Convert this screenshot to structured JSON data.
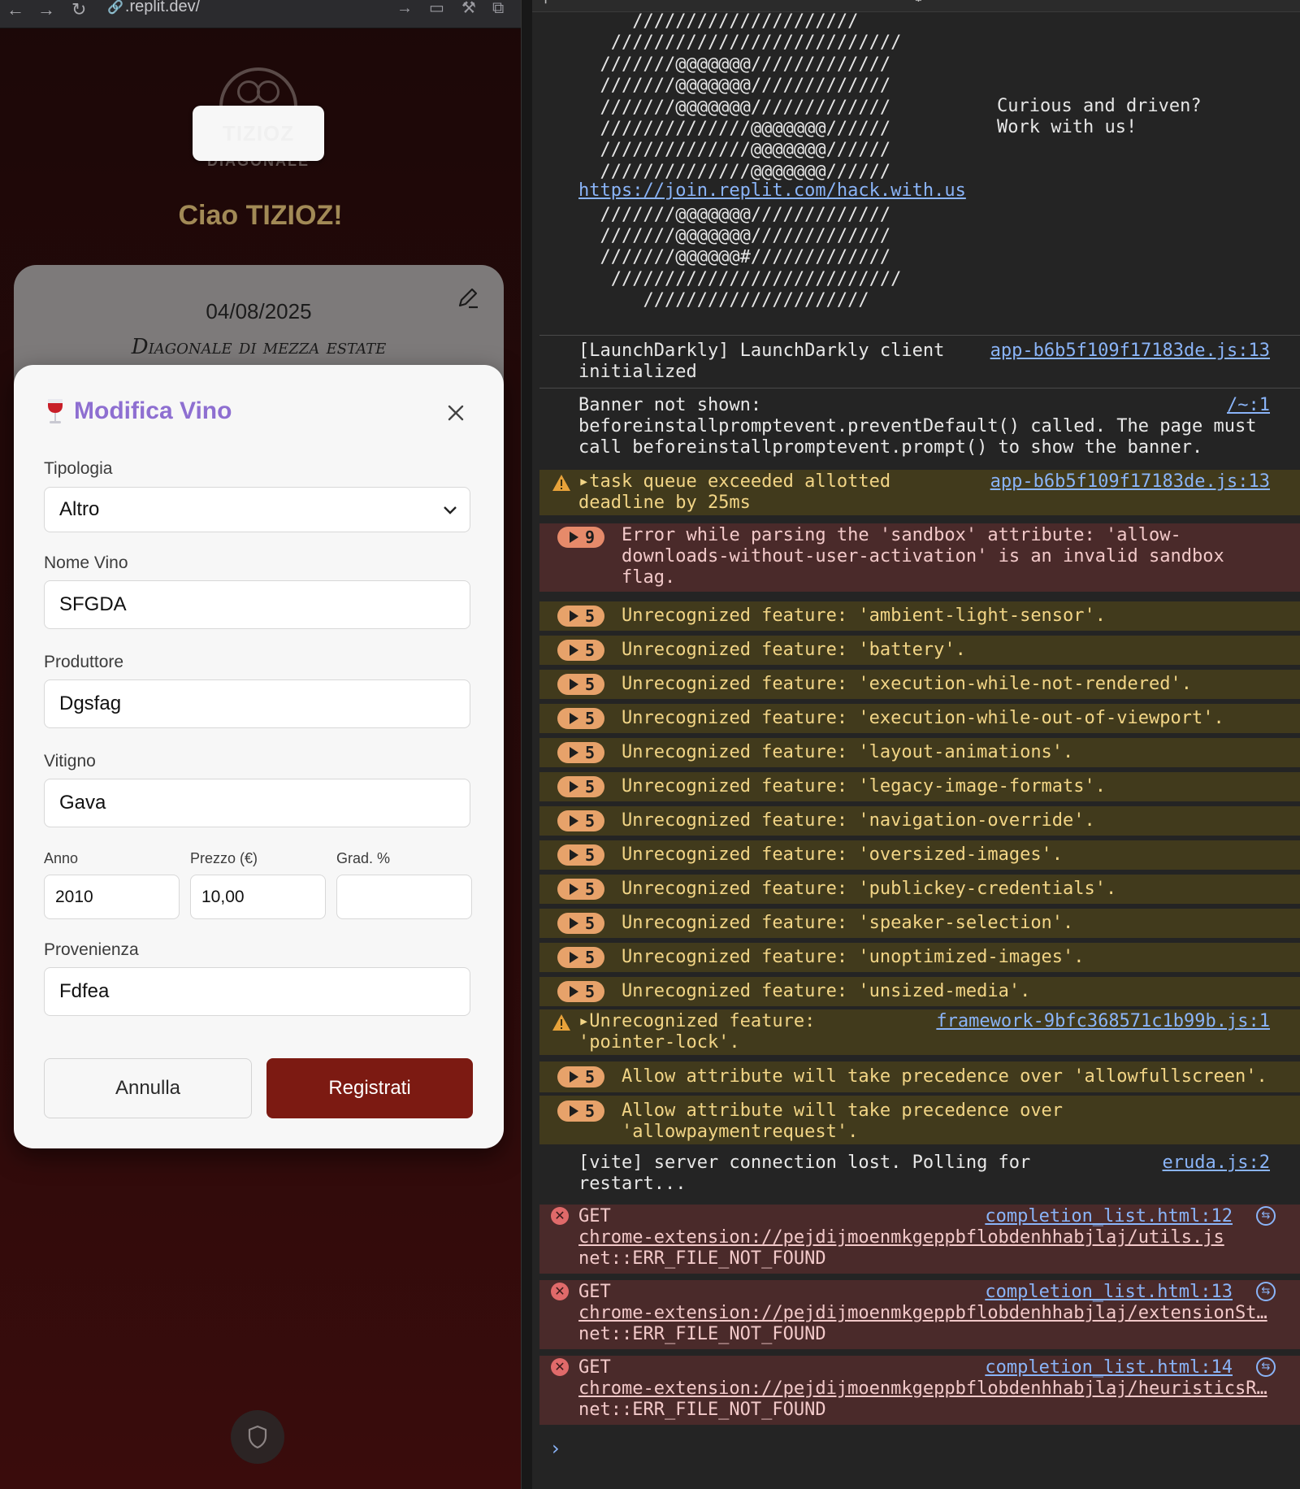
{
  "browser": {
    "url": ".replit.dev/",
    "back": "←",
    "forward": "→",
    "reload": "↻"
  },
  "app": {
    "logo_text": "TIZIOZ",
    "logo_subtext": "DIAGONALE",
    "greeting": "Ciao TIZIOZ!",
    "event": {
      "date": "04/08/2025",
      "title": "Diagonale di mezza estate"
    }
  },
  "modal": {
    "title": "Modifica Vino",
    "fields": {
      "tipologia": {
        "label": "Tipologia",
        "value": "Altro"
      },
      "nome_vino": {
        "label": "Nome Vino",
        "value": "SFGDA"
      },
      "produttore": {
        "label": "Produttore",
        "value": "Dgsfag"
      },
      "vitigno": {
        "label": "Vitigno",
        "value": "Gava"
      },
      "anno": {
        "label": "Anno",
        "value": "2010"
      },
      "prezzo": {
        "label": "Prezzo (€)",
        "value": "10,00"
      },
      "grad": {
        "label": "Grad. %",
        "value": ""
      },
      "provenienza": {
        "label": "Provenienza",
        "value": "Fdfea"
      }
    },
    "cancel_label": "Annulla",
    "submit_label": "Registrati",
    "accent": "#8e6fd1",
    "submit_color": "#7c1a12"
  },
  "console": {
    "ascii_art": "     /////////////////////\n   ///////////////////////////\n  ///////@@@@@@@/////////////\n  ///////@@@@@@@/////////////\n  ///////@@@@@@@/////////////\n  //////////////@@@@@@@//////\n  //////////////@@@@@@@//////\n  //////////////@@@@@@@//////\n\n  ///////@@@@@@@/////////////\n  ///////@@@@@@@/////////////\n  ///////@@@@@@#/////////////\n   ///////////////////////////\n      /////////////////////",
    "hack_link": "https://join.replit.com/hack.with.us",
    "curious_text": "Curious and driven?\nWork with us!",
    "launchdarkly": {
      "msg": "[LaunchDarkly] LaunchDarkly client\ninitialized",
      "src": "app-b6b5f109f17183de.js:13"
    },
    "banner": {
      "msg": "Banner not shown:\nbeforeinstallpromptevent.preventDefault() called. The page must\ncall beforeinstallpromptevent.prompt() to show the banner.",
      "src": "/~:1"
    },
    "task_warn": {
      "msg": "task queue exceeded allotted\ndeadline by 25ms",
      "src": "app-b6b5f109f17183de.js:13"
    },
    "sandbox": {
      "count": "9",
      "msg": "Error while parsing the 'sandbox' attribute: 'allow-\ndownloads-without-user-activation' is an invalid sandbox\nflag."
    },
    "features": [
      {
        "count": "5",
        "msg": "Unrecognized feature: 'ambient-light-sensor'."
      },
      {
        "count": "5",
        "msg": "Unrecognized feature: 'battery'."
      },
      {
        "count": "5",
        "msg": "Unrecognized feature: 'execution-while-not-rendered'."
      },
      {
        "count": "5",
        "msg": "Unrecognized feature: 'execution-while-out-of-viewport'."
      },
      {
        "count": "5",
        "msg": "Unrecognized feature: 'layout-animations'."
      },
      {
        "count": "5",
        "msg": "Unrecognized feature: 'legacy-image-formats'."
      },
      {
        "count": "5",
        "msg": "Unrecognized feature: 'navigation-override'."
      },
      {
        "count": "5",
        "msg": "Unrecognized feature: 'oversized-images'."
      },
      {
        "count": "5",
        "msg": "Unrecognized feature: 'publickey-credentials'."
      },
      {
        "count": "5",
        "msg": "Unrecognized feature: 'speaker-selection'."
      },
      {
        "count": "5",
        "msg": "Unrecognized feature: 'unoptimized-images'."
      },
      {
        "count": "5",
        "msg": "Unrecognized feature: 'unsized-media'."
      }
    ],
    "pointer_lock": {
      "msg": "Unrecognized feature:\n'pointer-lock'.",
      "src": "framework-9bfc368571c1b99b.js:1"
    },
    "allow1": {
      "count": "5",
      "msg": "Allow attribute will take precedence over 'allowfullscreen'."
    },
    "allow2": {
      "count": "5",
      "msg": "Allow attribute will take precedence over\n'allowpaymentrequest'."
    },
    "vite": {
      "msg": "[vite] server connection lost. Polling for\nrestart...",
      "src": "eruda.js:2"
    },
    "get_errors": [
      {
        "method": "GET",
        "src": "completion_list.html:12",
        "url": "chrome-extension://pejdijmoenmkgeppbflobdenhhabjlaj/utils.js",
        "status": "net::ERR_FILE_NOT_FOUND"
      },
      {
        "method": "GET",
        "src": "completion_list.html:13",
        "url": "chrome-extension://pejdijmoenmkgeppbflobdenhhabjlaj/extensionSt…",
        "status": "net::ERR_FILE_NOT_FOUND"
      },
      {
        "method": "GET",
        "src": "completion_list.html:14",
        "url": "chrome-extension://pejdijmoenmkgeppbflobdenhhabjlaj/heuristicsR…",
        "status": "net::ERR_FILE_NOT_FOUND"
      }
    ],
    "prompt": "›"
  }
}
